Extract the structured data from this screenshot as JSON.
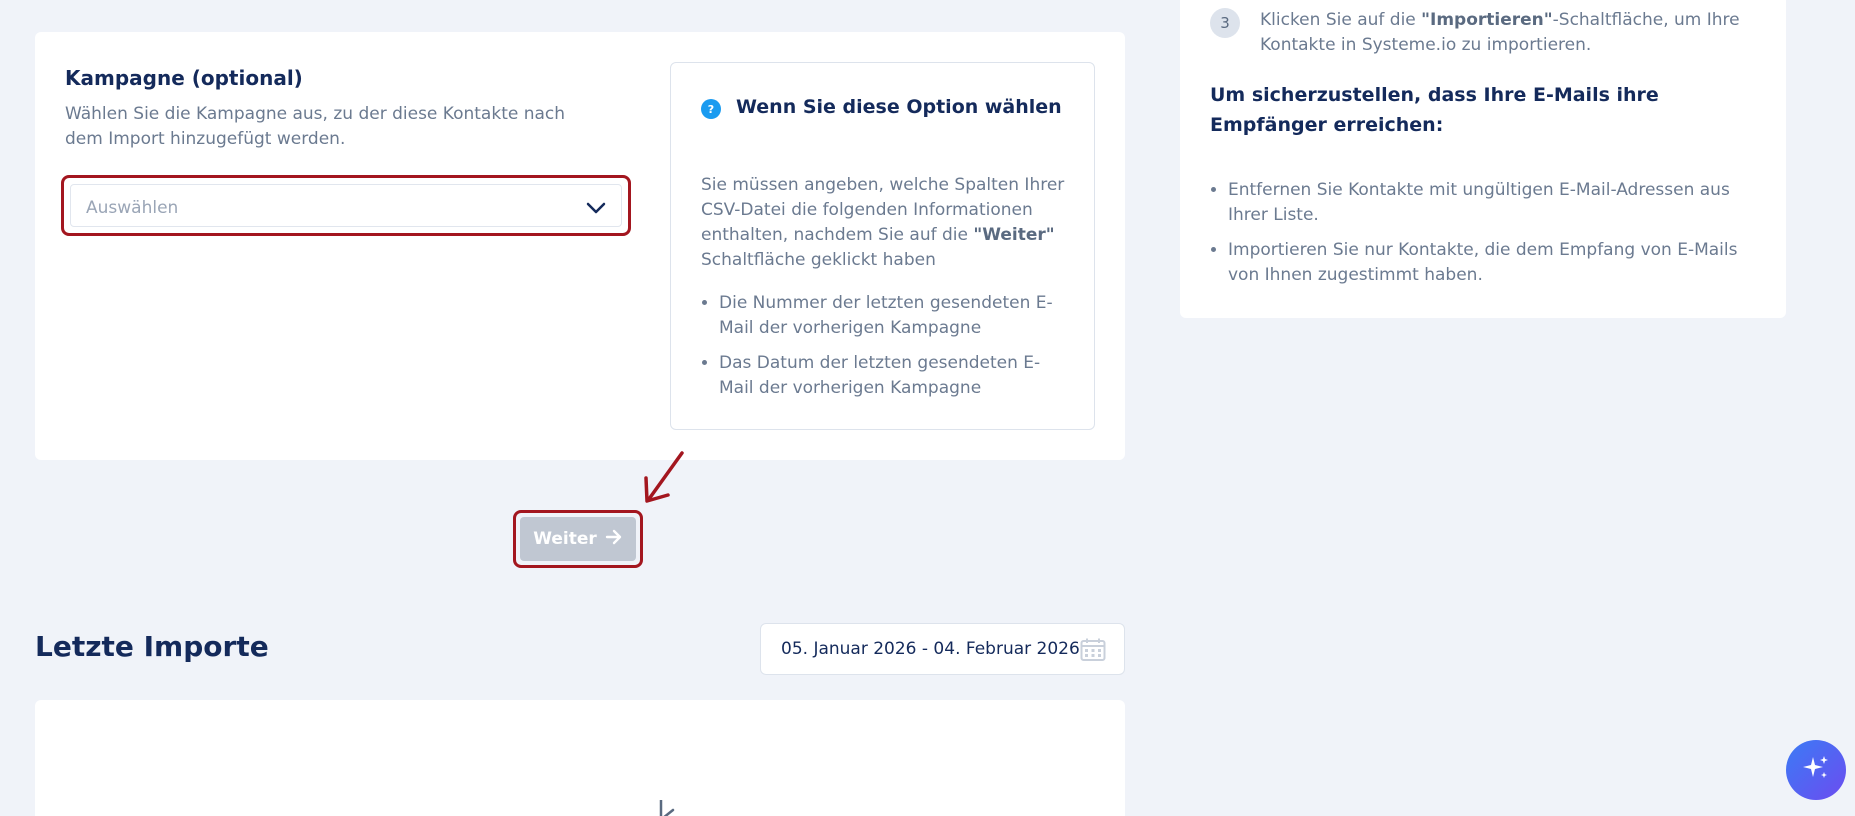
{
  "campaign": {
    "title": "Kampagne (optional)",
    "description": "Wählen Sie die Kampagne aus, zu der diese Kontakte nach dem Import hinzugefügt werden.",
    "select_placeholder": "Auswählen"
  },
  "info": {
    "title": "Wenn Sie diese Option wählen",
    "body_part1": "Sie müssen angeben, welche Spalten Ihrer CSV-Datei die folgenden Informationen enthalten, nachdem Sie auf die ",
    "body_bold": "\"Weiter\"",
    "body_part2": " Schaltfläche geklickt haben",
    "items": [
      "Die Nummer der letzten gesendeten E-Mail der vorherigen Kampagne",
      "Das Datum der letzten gesendeten E-Mail der vorherigen Kampagne"
    ]
  },
  "next_button": {
    "label": "Weiter"
  },
  "recent_imports": {
    "title": "Letzte Importe",
    "date_range": "05. Januar 2026 - 04. Februar 2026"
  },
  "steps": {
    "step3_number": "3",
    "step3_part1": "Klicken Sie auf die ",
    "step3_bold": "\"Importieren\"",
    "step3_part2": "-Schaltfläche, um Ihre Kontakte in Systeme.io zu importieren.",
    "warning_title": "Um sicherzustellen, dass Ihre E-Mails ihre Empfänger erreichen:",
    "warning_items": [
      "Entfernen Sie Kontakte mit ungültigen E-Mail-Adressen aus Ihrer Liste.",
      "Importieren Sie nur Kontakte, die dem Empfang von E-Mails von Ihnen zugestimmt haben."
    ]
  },
  "colors": {
    "background": "#f0f3f9",
    "heading": "#142a5b",
    "highlight": "#a3161f",
    "info_icon": "#1a9bf0",
    "button_disabled": "#c0c7d2"
  },
  "icons": {
    "select_chevron": "chevron-down-icon",
    "info": "question-circle-icon",
    "next": "arrow-right-icon",
    "calendar": "calendar-icon",
    "ai": "sparkle-icon",
    "annotation": "arrow-annotation"
  }
}
